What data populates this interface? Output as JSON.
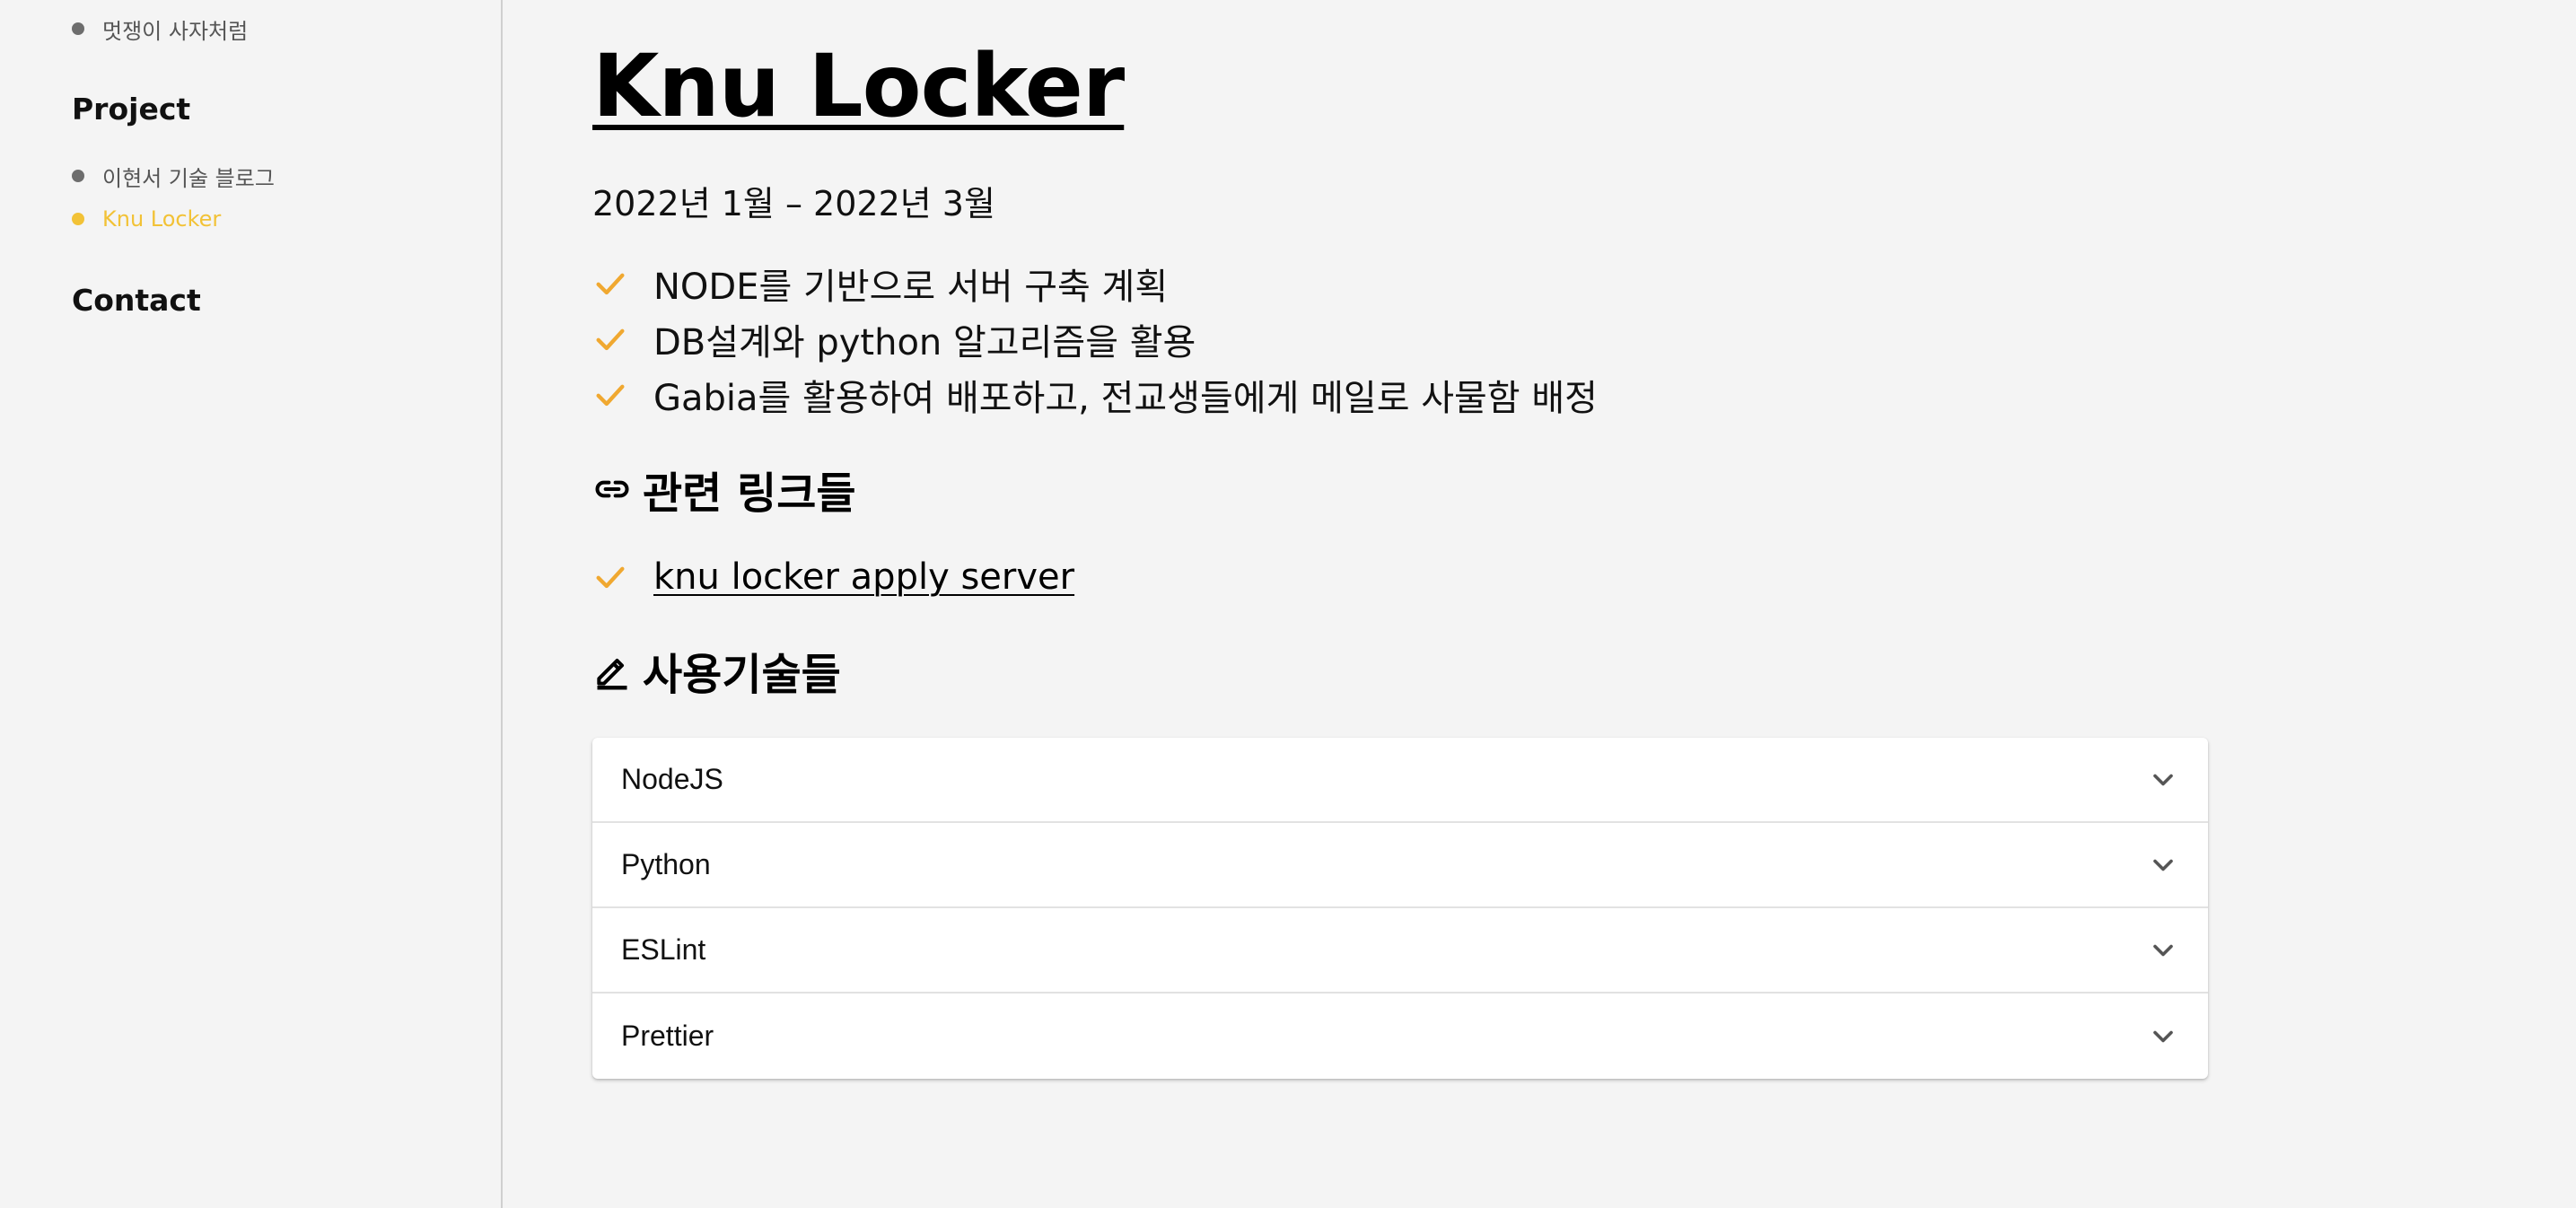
{
  "sidebar": {
    "top_item": "멋쟁이 사자처럼",
    "project_heading": "Project",
    "project_items": [
      "이현서 기술 블로그",
      "Knu Locker"
    ],
    "contact_heading": "Contact"
  },
  "main": {
    "title": "Knu Locker",
    "date": "2022년 1월 – 2022년 3월",
    "bullets": [
      "NODE를 기반으로 서버 구축 계획",
      "DB설계와 python 알고리즘을 활용",
      "Gabia를 활용하여 배포하고, 전교생들에게 메일로 사물함 배정"
    ],
    "links_heading": "관련 링크들",
    "links": [
      "knu locker apply server"
    ],
    "tech_heading": "사용기술들",
    "tech": [
      "NodeJS",
      "Python",
      "ESLint",
      "Prettier"
    ]
  },
  "colors": {
    "accent": "#f2c236",
    "check": "#f0a830",
    "background": "#f4f4f4"
  },
  "icons": {
    "bullet": "check-icon",
    "links": "link-icon",
    "tech": "pencil-icon",
    "accordion": "chevron-down-icon"
  }
}
